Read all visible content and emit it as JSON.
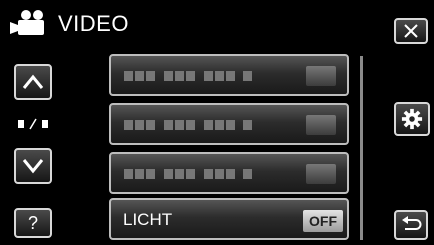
{
  "header": {
    "title": "VIDEO",
    "mode_icon": "movie-camera-icon"
  },
  "nav": {
    "up_icon": "chevron-up-icon",
    "down_icon": "chevron-down-icon",
    "help_label": "?",
    "page_indicator": "page-indicator-icon"
  },
  "controls": {
    "close_icon": "close-icon",
    "settings_icon": "gear-icon",
    "back_icon": "return-icon"
  },
  "menu": {
    "items": [
      {
        "label": "",
        "value": ""
      },
      {
        "label": "",
        "value": ""
      },
      {
        "label": "",
        "value": ""
      },
      {
        "label": "LICHT",
        "value": "OFF"
      }
    ]
  }
}
